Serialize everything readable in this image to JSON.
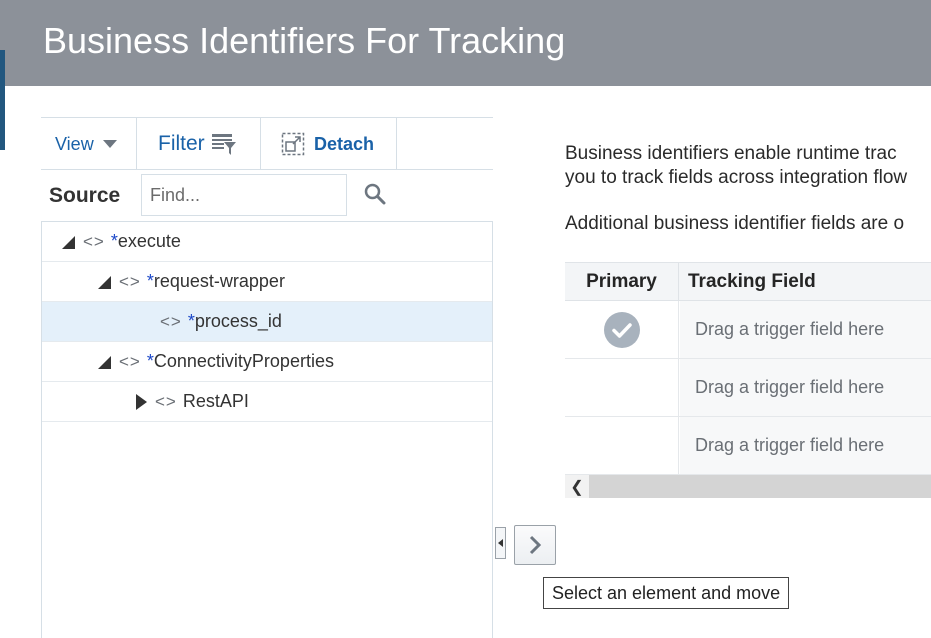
{
  "dialog": {
    "title": "Business Identifiers For Tracking"
  },
  "source": {
    "toolbar": {
      "view_label": "View",
      "filter_label": "Filter",
      "detach_label": "Detach"
    },
    "label": "Source",
    "find": {
      "placeholder": "Find...",
      "value": ""
    },
    "tree": [
      {
        "required_mark": "*",
        "name": "execute",
        "expander": "expanded",
        "selected": false
      },
      {
        "required_mark": "*",
        "name": "request-wrapper",
        "expander": "expanded",
        "selected": false
      },
      {
        "required_mark": "*",
        "name": "process_id",
        "expander": "none",
        "selected": true
      },
      {
        "required_mark": "*",
        "name": "ConnectivityProperties",
        "expander": "expanded",
        "selected": false
      },
      {
        "required_mark": "",
        "name": "RestAPI",
        "expander": "collapsed",
        "selected": false
      }
    ]
  },
  "description": {
    "line1": "Business identifiers enable runtime trac",
    "line2": "you to track fields across integration flow",
    "line3": "Additional business identifier fields are o"
  },
  "tracking_table": {
    "columns": [
      "Primary",
      "Tracking Field"
    ],
    "rows": [
      {
        "primary": true,
        "tracking_field_placeholder": "Drag a trigger field here"
      },
      {
        "primary": false,
        "tracking_field_placeholder": "Drag a trigger field here"
      },
      {
        "primary": false,
        "tracking_field_placeholder": "Drag a trigger field here"
      }
    ]
  },
  "move_control": {
    "tooltip": "Select an element and move"
  },
  "colors": {
    "title_bar": "#8c9199",
    "link_blue": "#1a62a8",
    "selected_row": "#e4f0fa",
    "required_mark": "#1a46c8"
  }
}
